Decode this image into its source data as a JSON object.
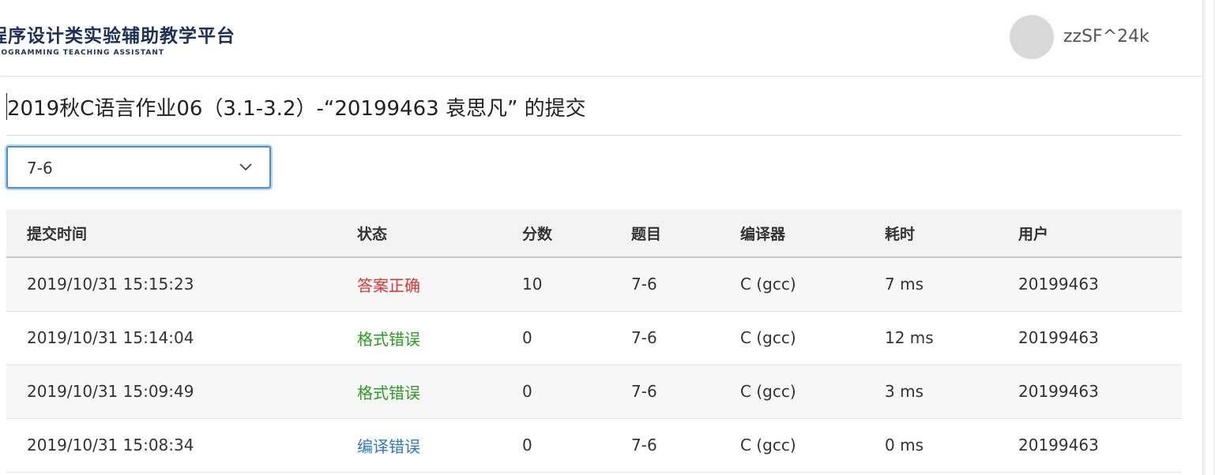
{
  "header": {
    "logo_title": "程序设计类实验辅助教学平台",
    "logo_subtitle": "PROGRAMMING TEACHING ASSISTANT",
    "username": "zzSF^24k"
  },
  "page": {
    "title": "2019秋C语言作业06（3.1-3.2）-“20199463 袁思凡” 的提交"
  },
  "problem_select": {
    "value": "7-6"
  },
  "table": {
    "columns": [
      "提交时间",
      "状态",
      "分数",
      "题目",
      "编译器",
      "耗时",
      "用户"
    ],
    "rows": [
      {
        "time": "2019/10/31 15:15:23",
        "status": "答案正确",
        "status_color": "#e0342f",
        "score": "10",
        "problem": "7-6",
        "compiler": "C (gcc)",
        "duration": "7 ms",
        "user": "20199463"
      },
      {
        "time": "2019/10/31 15:14:04",
        "status": "格式错误",
        "status_color": "#2a9d1f",
        "score": "0",
        "problem": "7-6",
        "compiler": "C (gcc)",
        "duration": "12 ms",
        "user": "20199463"
      },
      {
        "time": "2019/10/31 15:09:49",
        "status": "格式错误",
        "status_color": "#2a9d1f",
        "score": "0",
        "problem": "7-6",
        "compiler": "C (gcc)",
        "duration": "3 ms",
        "user": "20199463"
      },
      {
        "time": "2019/10/31 15:08:34",
        "status": "编译错误",
        "status_color": "#2f78c4",
        "score": "0",
        "problem": "7-6",
        "compiler": "C (gcc)",
        "duration": "0 ms",
        "user": "20199463"
      }
    ]
  },
  "icons": {
    "select_chevron": "chevron-down-icon"
  }
}
